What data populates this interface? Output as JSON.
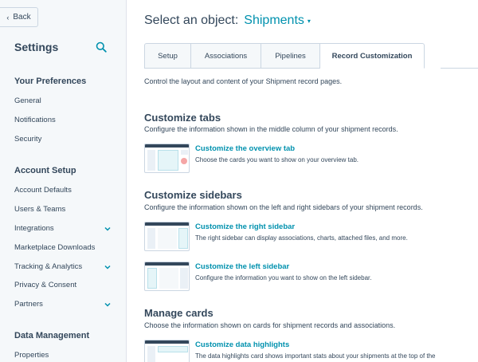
{
  "sidebar": {
    "back_label": "Back",
    "title": "Settings",
    "sections": [
      {
        "heading": "Your Preferences",
        "items": [
          {
            "label": "General",
            "expandable": false
          },
          {
            "label": "Notifications",
            "expandable": false
          },
          {
            "label": "Security",
            "expandable": false
          }
        ]
      },
      {
        "heading": "Account Setup",
        "items": [
          {
            "label": "Account Defaults",
            "expandable": false
          },
          {
            "label": "Users & Teams",
            "expandable": false
          },
          {
            "label": "Integrations",
            "expandable": true
          },
          {
            "label": "Marketplace Downloads",
            "expandable": false
          },
          {
            "label": "Tracking & Analytics",
            "expandable": true
          },
          {
            "label": "Privacy & Consent",
            "expandable": false
          },
          {
            "label": "Partners",
            "expandable": true
          }
        ]
      },
      {
        "heading": "Data Management",
        "items": [
          {
            "label": "Properties",
            "expandable": false
          }
        ]
      }
    ]
  },
  "main": {
    "select_label": "Select an object:",
    "object_name": "Shipments",
    "tabs": [
      {
        "label": "Setup",
        "active": false
      },
      {
        "label": "Associations",
        "active": false
      },
      {
        "label": "Pipelines",
        "active": false
      },
      {
        "label": "Record Customization",
        "active": true
      }
    ],
    "intro": "Control the layout and content of your Shipment record pages.",
    "sections": [
      {
        "title": "Customize tabs",
        "description": "Configure the information shown in the middle column of your shipment records.",
        "cards": [
          {
            "link": "Customize the overview tab",
            "description": "Choose the cards you want to show on your overview tab."
          }
        ]
      },
      {
        "title": "Customize sidebars",
        "description": "Configure the information shown on the left and right sidebars of your shipment records.",
        "cards": [
          {
            "link": "Customize the right sidebar",
            "description": "The right sidebar can display associations, charts, attached files, and more."
          },
          {
            "link": "Customize the left sidebar",
            "description": "Configure the information you want to show on the left sidebar."
          }
        ]
      },
      {
        "title": "Manage cards",
        "description": "Choose the information shown on cards for shipment records and associations.",
        "cards": [
          {
            "link": "Customize data highlights",
            "description": "The data highlights card shows important stats about your shipments at the top of the"
          }
        ]
      }
    ]
  },
  "colors": {
    "accent": "#0091ae",
    "text": "#33475b",
    "sidebar_bg": "#f5f8fa",
    "border": "#cbd6e2"
  }
}
